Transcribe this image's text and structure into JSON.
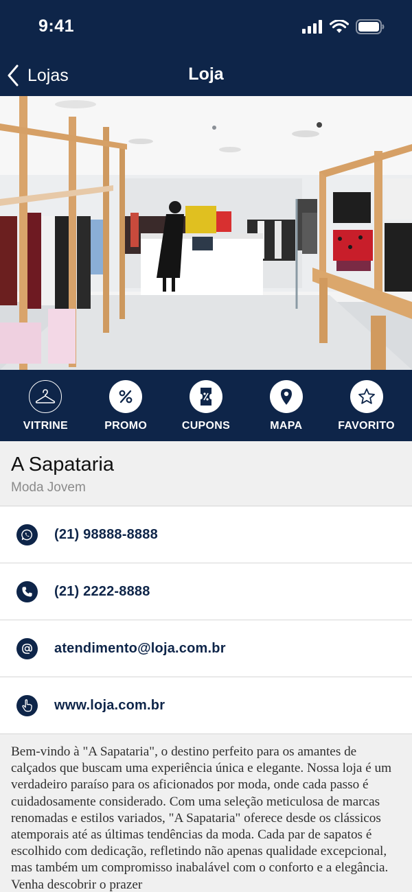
{
  "status_bar": {
    "time": "9:41"
  },
  "nav": {
    "back_label": "Lojas",
    "title": "Loja"
  },
  "actions": [
    {
      "label": "VITRINE",
      "icon": "hanger-icon"
    },
    {
      "label": "PROMO",
      "icon": "percent-icon"
    },
    {
      "label": "CUPONS",
      "icon": "coupon-icon"
    },
    {
      "label": "MAPA",
      "icon": "map-pin-icon"
    },
    {
      "label": "FAVORITO",
      "icon": "star-icon"
    }
  ],
  "store": {
    "name": "A Sapataria",
    "category": "Moda Jovem"
  },
  "contacts": [
    {
      "type": "whatsapp",
      "icon": "whatsapp-icon",
      "value": "(21) 98888-8888"
    },
    {
      "type": "phone",
      "icon": "phone-icon",
      "value": "(21) 2222-8888"
    },
    {
      "type": "email",
      "icon": "at-icon",
      "value": "atendimento@loja.com.br"
    },
    {
      "type": "website",
      "icon": "pointer-hand-icon",
      "value": "www.loja.com.br"
    }
  ],
  "description": "Bem-vindo à \"A Sapataria\", o destino perfeito para os amantes de calçados que buscam uma experiência única e elegante. Nossa loja é um verdadeiro paraíso para os aficionados por moda, onde cada passo é cuidadosamente considerado. Com uma seleção meticulosa de marcas renomadas e estilos variados, \"A Sapataria\" oferece desde os clássicos atemporais até as últimas tendências da moda. Cada par de sapatos é escolhido com dedicação, refletindo não apenas qualidade excepcional, mas também um compromisso inabalável com o conforto e a elegância. Venha descobrir o prazer",
  "colors": {
    "navy": "#0e2549",
    "panel_gray": "#f0f0f0",
    "divider": "#d6d6d6"
  }
}
